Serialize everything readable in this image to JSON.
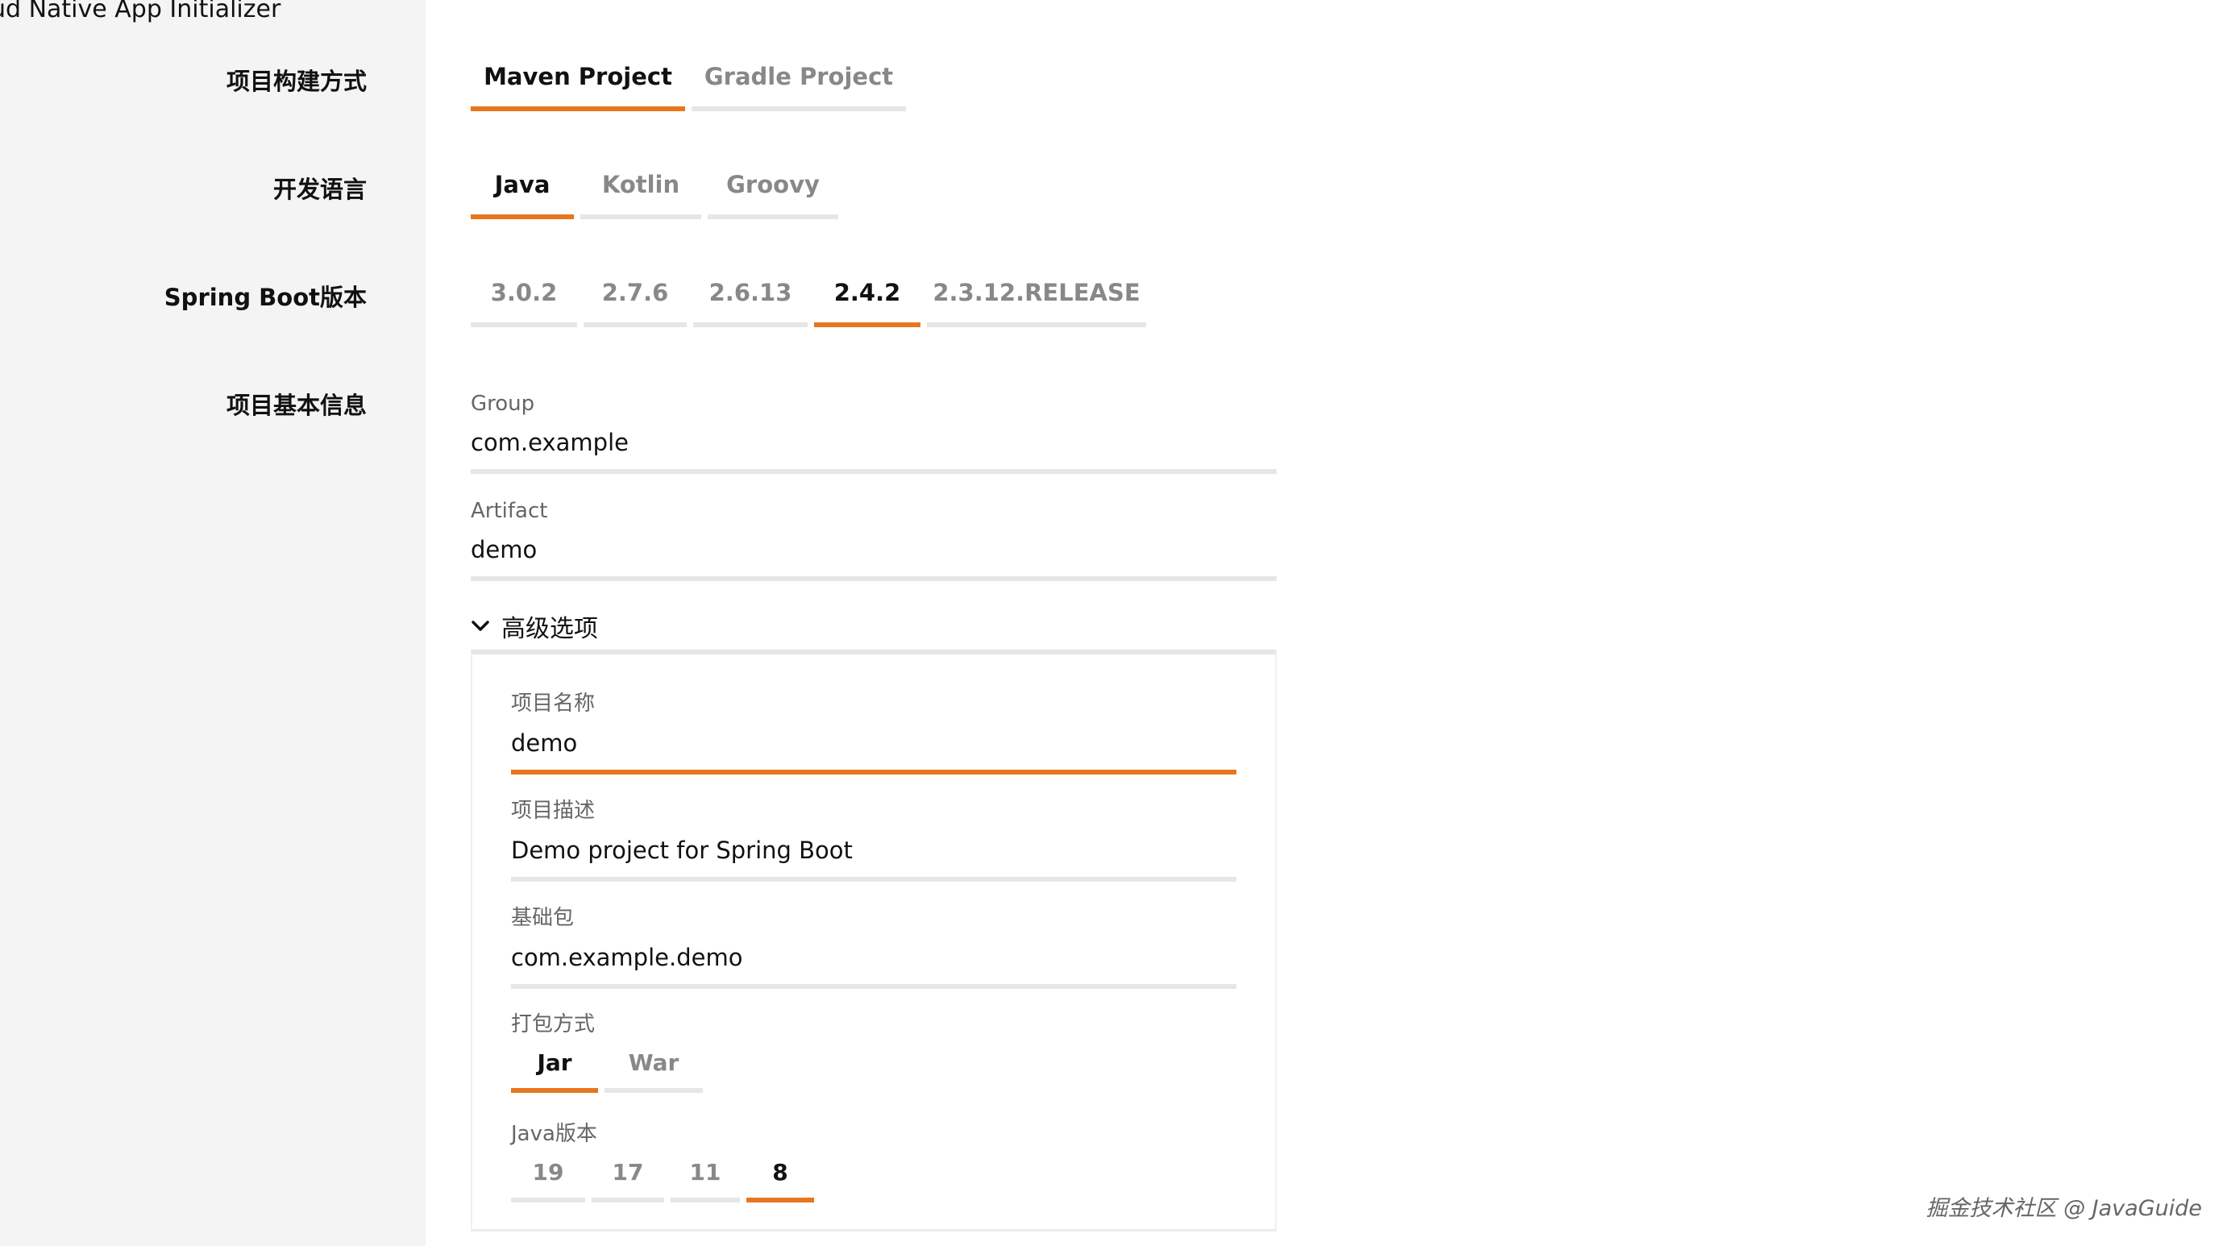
{
  "app": {
    "title": "ud Native App Initializer"
  },
  "build": {
    "label": "项目构建方式",
    "options": [
      "Maven Project",
      "Gradle Project"
    ],
    "selected": "Maven Project"
  },
  "language": {
    "label": "开发语言",
    "options": [
      "Java",
      "Kotlin",
      "Groovy"
    ],
    "selected": "Java"
  },
  "boot": {
    "label": "Spring Boot版本",
    "options": [
      "3.0.2",
      "2.7.6",
      "2.6.13",
      "2.4.2",
      "2.3.12.RELEASE"
    ],
    "selected": "2.4.2"
  },
  "info": {
    "label": "项目基本信息",
    "group": {
      "label": "Group",
      "value": "com.example"
    },
    "artifact": {
      "label": "Artifact",
      "value": "demo"
    }
  },
  "advanced": {
    "toggle_label": "高级选项",
    "name": {
      "label": "项目名称",
      "value": "demo"
    },
    "description": {
      "label": "项目描述",
      "value": "Demo project for Spring Boot"
    },
    "package": {
      "label": "基础包",
      "value": "com.example.demo"
    },
    "packaging": {
      "label": "打包方式",
      "options": [
        "Jar",
        "War"
      ],
      "selected": "Jar"
    },
    "java": {
      "label": "Java版本",
      "options": [
        "19",
        "17",
        "11",
        "8"
      ],
      "selected": "8"
    }
  },
  "watermark": "掘金技术社区 @ JavaGuide",
  "colors": {
    "accent": "#e8761e",
    "inactive_line": "#e6e6e6",
    "sidebar_bg": "#f4f4f4"
  },
  "icons": {
    "advanced_toggle": "chevron-down-icon"
  }
}
